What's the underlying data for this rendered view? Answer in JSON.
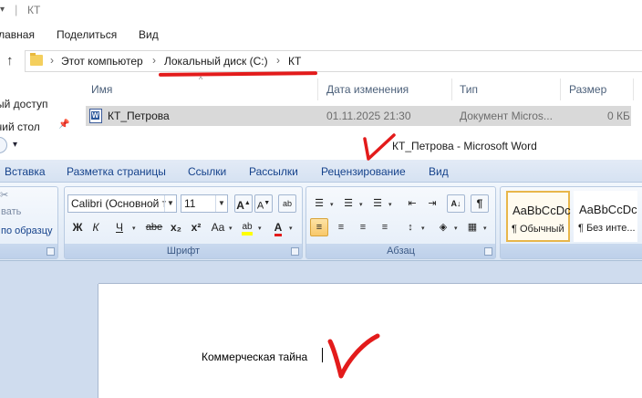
{
  "explorer": {
    "title": "КТ",
    "ribbon_tabs": [
      "главная",
      "Поделиться",
      "Вид"
    ],
    "address": {
      "crumbs": [
        "Этот компьютер",
        "Локальный диск (C:)",
        "КТ"
      ]
    },
    "nav_items": [
      "быстрый доступ",
      "Рабочий стол"
    ],
    "nav_items_visible": [
      "ый доступ",
      "чий стол"
    ],
    "columns": [
      "Имя",
      "Дата изменения",
      "Тип",
      "Размер"
    ],
    "files": [
      {
        "name": "КТ_Петрова",
        "date": "01.11.2025 21:30",
        "type": "Документ Micros...",
        "size": "0 КБ"
      }
    ],
    "colors": {
      "annotation": "#e31b1b",
      "selection": "#d9d9d9"
    }
  },
  "word": {
    "title": "КТ_Петрова - Microsoft Word",
    "tabs": [
      "Вставка",
      "Разметка страницы",
      "Ссылки",
      "Рассылки",
      "Рецензирование",
      "Вид"
    ],
    "clipboard_items": [
      "вать",
      "по образцу"
    ],
    "font": {
      "name": "Calibri (Основной те",
      "size": "11",
      "group_label": "Шрифт",
      "buttons": {
        "grow": "A",
        "shrink": "A",
        "clear": "ab",
        "bold": "Ж",
        "italic": "К",
        "underline": "Ч",
        "strike": "abe",
        "subscript": "x₂",
        "superscript": "x²",
        "case": "Aa",
        "highlight": "ab",
        "font_color": "A"
      }
    },
    "paragraph": {
      "group_label": "Абзац",
      "sort": "А↓",
      "pilcrow": "¶"
    },
    "styles": [
      {
        "sample": "AaBbCcDc",
        "name": "¶ Обычный",
        "selected": true
      },
      {
        "sample": "AaBbCcDc",
        "name": "¶ Без инте...",
        "selected": false
      }
    ],
    "document_text": "Коммерческая тайна",
    "colors": {
      "ribbon": "#dbe6f4",
      "tab_text": "#15428b",
      "highlight": "#ffff00",
      "font_color": "#e31b1b"
    }
  },
  "icons": [
    "up-arrow-icon",
    "folder-icon",
    "chevron-right-icon",
    "pin-icon",
    "word-doc-icon",
    "dropdown-icon",
    "checkmark-annotation"
  ]
}
